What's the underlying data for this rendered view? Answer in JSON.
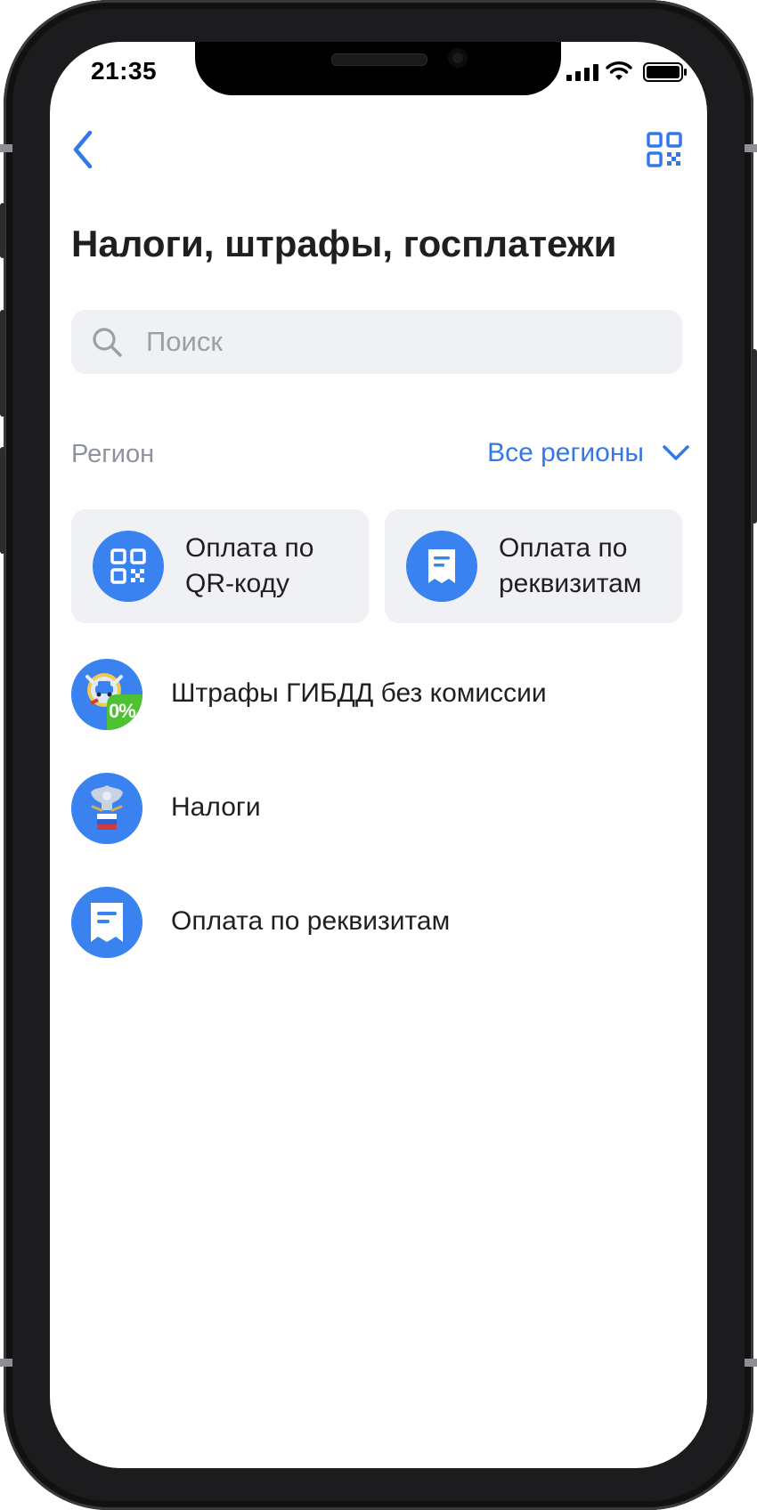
{
  "status_bar": {
    "time": "21:35"
  },
  "header": {
    "back_icon": "chevron-left-icon",
    "qr_icon": "qr-code-icon",
    "title": "Налоги, штрафы, госплатежи"
  },
  "search": {
    "placeholder": "Поиск",
    "value": ""
  },
  "region": {
    "label": "Регион",
    "value": "Все регионы"
  },
  "cards": [
    {
      "line1": "Оплата по",
      "line2": "QR-коду",
      "icon": "qr-code-icon"
    },
    {
      "line1": "Оплата по",
      "line2": "реквизитам",
      "icon": "receipt-icon"
    }
  ],
  "list": [
    {
      "label": "Штрафы ГИБДД без комиссии",
      "icon": "traffic-police-icon",
      "badge": "0%"
    },
    {
      "label": "Налоги",
      "icon": "tax-service-emblem-icon"
    },
    {
      "label": "Оплата по реквизитам",
      "icon": "receipt-icon"
    }
  ],
  "colors": {
    "accent": "#3a82f0",
    "link": "#3478e8",
    "card_bg": "#f0f1f4",
    "green_badge": "#4fc234"
  }
}
